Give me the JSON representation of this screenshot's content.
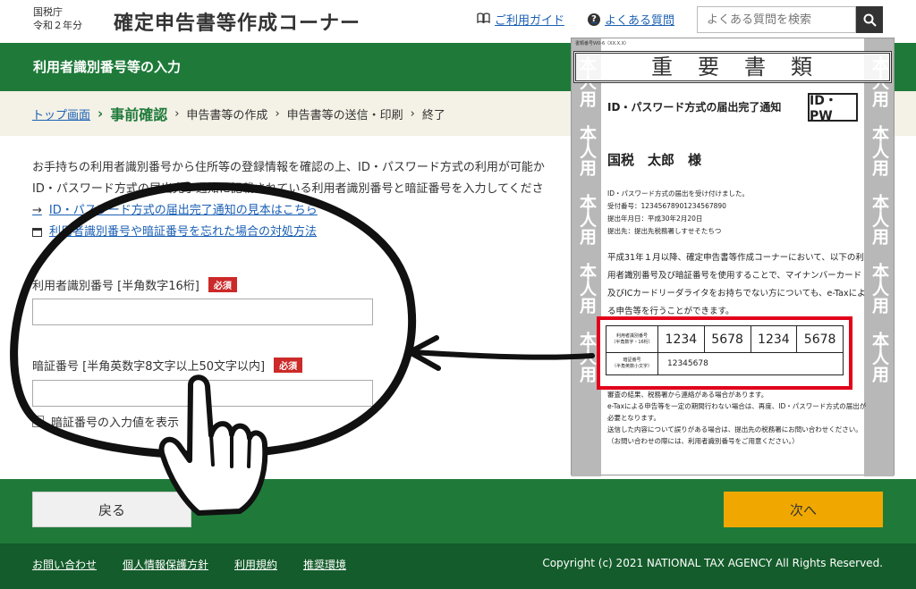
{
  "header": {
    "agency_line1": "国税庁",
    "agency_line2": "令和２年分",
    "site_title": "確定申告書等作成コーナー",
    "guide_link": "ご利用ガイド",
    "faq_link": "よくある質問",
    "search_placeholder": "よくある質問を検索"
  },
  "page_title": "利用者識別番号等の入力",
  "steps": {
    "top": "トップ画面",
    "current": "事前確認",
    "s3": "申告書等の作成",
    "s4": "申告書等の送信・印刷",
    "s5": "終了"
  },
  "content": {
    "line1": "お手持ちの利用者識別番号から住所等の登録情報を確認の上、ID・パスワード方式の利用が可能か",
    "line2": "ID・パスワード方式の届出完了通知に記載されている利用者識別番号と暗証番号を入力してくださ",
    "link1": "ID・パスワード方式の届出完了通知の見本はこちら",
    "link2": "利用者識別番号や暗証番号を忘れた場合の対処方法",
    "field1_label": "利用者識別番号 [半角数字16桁]",
    "field2_label": "暗証番号 [半角英数字8文字以上50文字以内]",
    "required": "必須",
    "checkbox_label": "暗証番号の入力値を表示"
  },
  "buttons": {
    "back": "戻る",
    "next": "次へ"
  },
  "footer": {
    "contact": "お問い合わせ",
    "privacy": "個人情報保護方針",
    "terms": "利用規約",
    "env": "推奨環境",
    "copyright": "Copyright (c) 2021 NATIONAL TAX AGENCY All Rights Reserved."
  },
  "document": {
    "form_no": "書類番号Ｗ0-6（XX.X.X）",
    "banner": "重要書類",
    "side_text": "本人用",
    "title": "ID・パスワード方式の届出完了通知",
    "idpw": "ID・PW",
    "name": "国税　太郎　様",
    "accepted": "ID・パスワード方式の届出を受け付けました。",
    "receipt": "受付番号：12345678901234567890",
    "date": "提出年月日：平成30年2月20日",
    "office": "提出先：提出先税務署しすせそたちつ",
    "para": "平成31年１月以降、確定申告書等作成コーナーにおいて、以下の利用者識別番号及び暗証番号を使用することで、マイナンバーカード及びICカードリーダライタをお持ちでない方についても、e-Taxによる申告等を行うことができます。",
    "id_label": "利用者識別番号",
    "id_sub": "（半角数字・16桁）",
    "pin_label": "暗証番号",
    "pin_sub": "（半角英数小文字）",
    "id_parts": [
      "1234",
      "5678",
      "1234",
      "5678"
    ],
    "pin": "12345678",
    "note1": "審査の結果、税務署から連絡がある場合があります。",
    "note2": "e-Taxによる申告等を一定の期間行わない場合は、再度、ID・パスワード方式の届出が必要となります。",
    "note3": "送信した内容について誤りがある場合は、提出先の税務署にお問い合わせください。",
    "note4": "（お問い合わせの際には、利用者識別番号をご用意ください。）"
  },
  "colors": {
    "green": "#1f7a3a",
    "dark_green": "#145c2b",
    "next_button": "#f0a800",
    "required_badge": "#cc2929",
    "highlight_box": "#e2001a"
  }
}
